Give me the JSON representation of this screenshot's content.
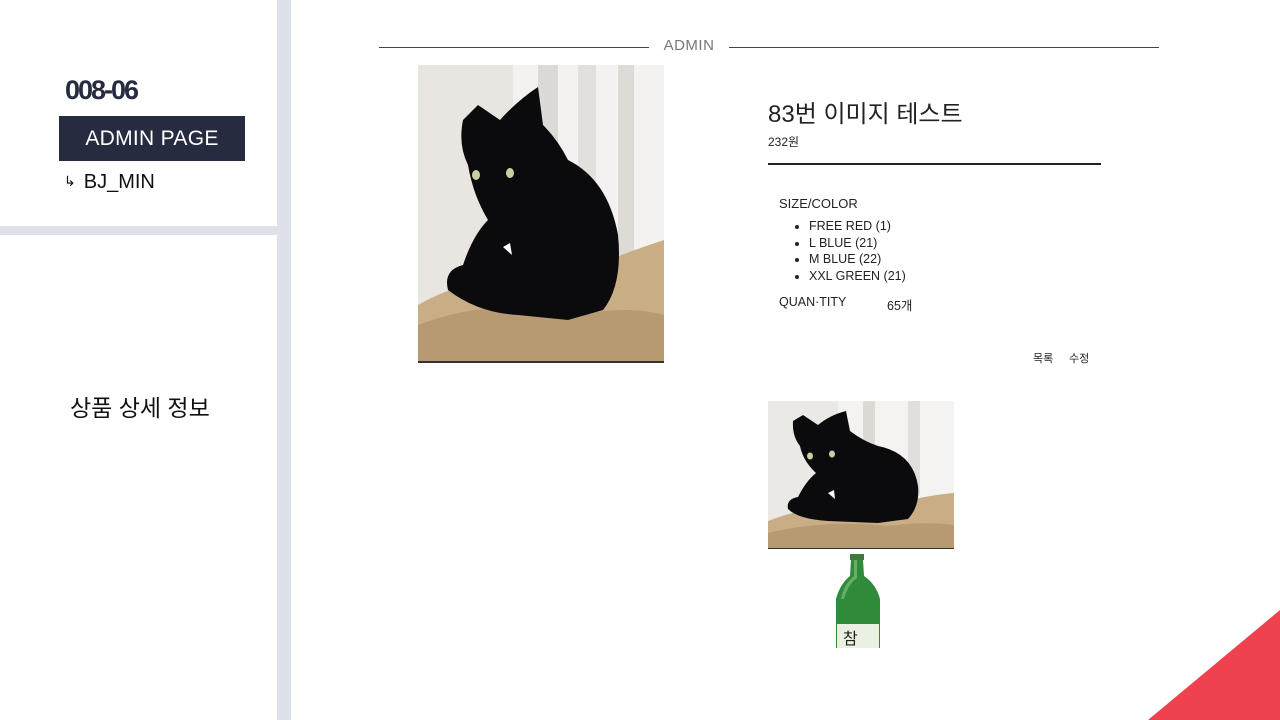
{
  "slide": {
    "number": "008-06",
    "badge": "ADMIN PAGE",
    "user": "BJ_MIN",
    "user_arrow": "↳",
    "section": "상품 상세 정보"
  },
  "header": {
    "title": "ADMIN"
  },
  "product": {
    "title": "83번 이미지 테스트",
    "price": "232원",
    "size_label": "SIZE/COLOR",
    "options": [
      "FREE RED (1)",
      "L BLUE (21)",
      "M BLUE (22)",
      "XXL GREEN (21)"
    ],
    "quantity_label": "QUAN·TITY",
    "quantity_value": "65개"
  },
  "actions": {
    "list_label": "목록",
    "edit_label": "수정"
  },
  "bottle_label": "참",
  "colors": {
    "accent": "#f0414f",
    "navy": "#262b40",
    "divider": "#dfe1e8"
  }
}
